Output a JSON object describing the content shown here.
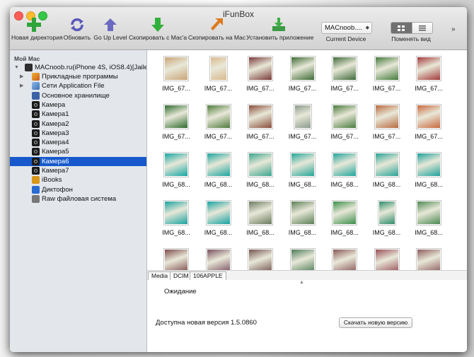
{
  "window": {
    "title": "iFunBox"
  },
  "toolbar": {
    "buttons": [
      {
        "label": "Новая директория",
        "icon": "green-plus-icon"
      },
      {
        "label": "Обновить",
        "icon": "refresh-icon"
      },
      {
        "label": "Go Up Level",
        "icon": "up-arrow-icon"
      },
      {
        "label": "Скопировать с Mac'a",
        "icon": "green-down-arrow-icon"
      },
      {
        "label": "Скопировать на Mac",
        "icon": "orange-arrow-icon"
      },
      {
        "label": "Установить приложение",
        "icon": "install-icon"
      }
    ],
    "device_select": {
      "value": "MACnoob....",
      "label": "Current Device"
    },
    "view_label": "Поменять вид",
    "more": "»"
  },
  "sidebar": {
    "header": "Мой Mac",
    "device": "MACnoob.ru(iPhone 4S, iOS8.4)[Jailed]",
    "items": [
      {
        "label": "Прикладные программы",
        "icon": "apps-icon",
        "disclosure": "▶"
      },
      {
        "label": "Сети Application File",
        "icon": "network-icon",
        "disclosure": "▶"
      },
      {
        "label": "Основное хранилище",
        "icon": "storage-icon",
        "disclosure": ""
      },
      {
        "label": "Камера",
        "icon": "camera-icon",
        "disclosure": ""
      },
      {
        "label": "Камера1",
        "icon": "camera-icon",
        "disclosure": ""
      },
      {
        "label": "Камера2",
        "icon": "camera-icon",
        "disclosure": ""
      },
      {
        "label": "Камера3",
        "icon": "camera-icon",
        "disclosure": ""
      },
      {
        "label": "Камера4",
        "icon": "camera-icon",
        "disclosure": ""
      },
      {
        "label": "Камера5",
        "icon": "camera-icon",
        "disclosure": ""
      },
      {
        "label": "Камера6",
        "icon": "camera-icon",
        "disclosure": "",
        "selected": true
      },
      {
        "label": "Камера7",
        "icon": "camera-icon",
        "disclosure": ""
      },
      {
        "label": "iBooks",
        "icon": "books-icon",
        "disclosure": ""
      },
      {
        "label": "Диктофон",
        "icon": "voice-memo-icon",
        "disclosure": ""
      },
      {
        "label": "Raw файловая система",
        "icon": "raw-fs-icon",
        "disclosure": ""
      }
    ]
  },
  "files": [
    {
      "name": "IMG_67...",
      "color": "#c9a577"
    },
    {
      "name": "IMG_67...",
      "color": "#d9b98d"
    },
    {
      "name": "IMG_67...",
      "color": "#7a3b3b"
    },
    {
      "name": "IMG_67...",
      "color": "#3e6b35"
    },
    {
      "name": "IMG_67...",
      "color": "#3f6a3a"
    },
    {
      "name": "IMG_67...",
      "color": "#447a3c"
    },
    {
      "name": "IMG_67...",
      "color": "#a23a3a"
    },
    {
      "name": "IMG_67...",
      "color": "#2f6b2e"
    },
    {
      "name": "IMG_67...",
      "color": "#4f7a3b"
    },
    {
      "name": "IMG_67...",
      "color": "#8a4d3b"
    },
    {
      "name": "IMG_67...",
      "color": "#8a9a8c"
    },
    {
      "name": "IMG_67...",
      "color": "#4a7b3c"
    },
    {
      "name": "IMG_67...",
      "color": "#b9693f"
    },
    {
      "name": "IMG_67...",
      "color": "#c9683e"
    },
    {
      "name": "IMG_68...",
      "color": "#17a7a3"
    },
    {
      "name": "IMG_68...",
      "color": "#1ca69f"
    },
    {
      "name": "IMG_68...",
      "color": "#3aa58d"
    },
    {
      "name": "IMG_68...",
      "color": "#24a698"
    },
    {
      "name": "IMG_68...",
      "color": "#21a59c"
    },
    {
      "name": "IMG_68...",
      "color": "#29a497"
    },
    {
      "name": "IMG_68...",
      "color": "#1fa29b"
    },
    {
      "name": "IMG_68...",
      "color": "#1aa3a0"
    },
    {
      "name": "IMG_68...",
      "color": "#17a2a2"
    },
    {
      "name": "IMG_68...",
      "color": "#6b7a5f"
    },
    {
      "name": "IMG_68...",
      "color": "#5c7f56"
    },
    {
      "name": "IMG_68...",
      "color": "#3b8f4a"
    },
    {
      "name": "IMG_68...",
      "color": "#2e8c6c"
    },
    {
      "name": "IMG_68...",
      "color": "#4c8a52"
    },
    {
      "name": "",
      "color": "#7e4b4b"
    },
    {
      "name": "",
      "color": "#7a5060"
    },
    {
      "name": "",
      "color": "#73534d"
    },
    {
      "name": "",
      "color": "#4e7c58"
    },
    {
      "name": "",
      "color": "#8a5656"
    },
    {
      "name": "",
      "color": "#9a4f57"
    },
    {
      "name": "",
      "color": "#8d5b5b"
    }
  ],
  "path": [
    "Media",
    "DCIM",
    "106APPLE"
  ],
  "status": {
    "waiting": "Ожидание",
    "new_version": "Доступна новая версия 1.5.0860",
    "download_button": "Скачать новую версию"
  },
  "colors": {
    "selection": "#1759cc",
    "sidebar_bg": "#e3e7ec"
  }
}
